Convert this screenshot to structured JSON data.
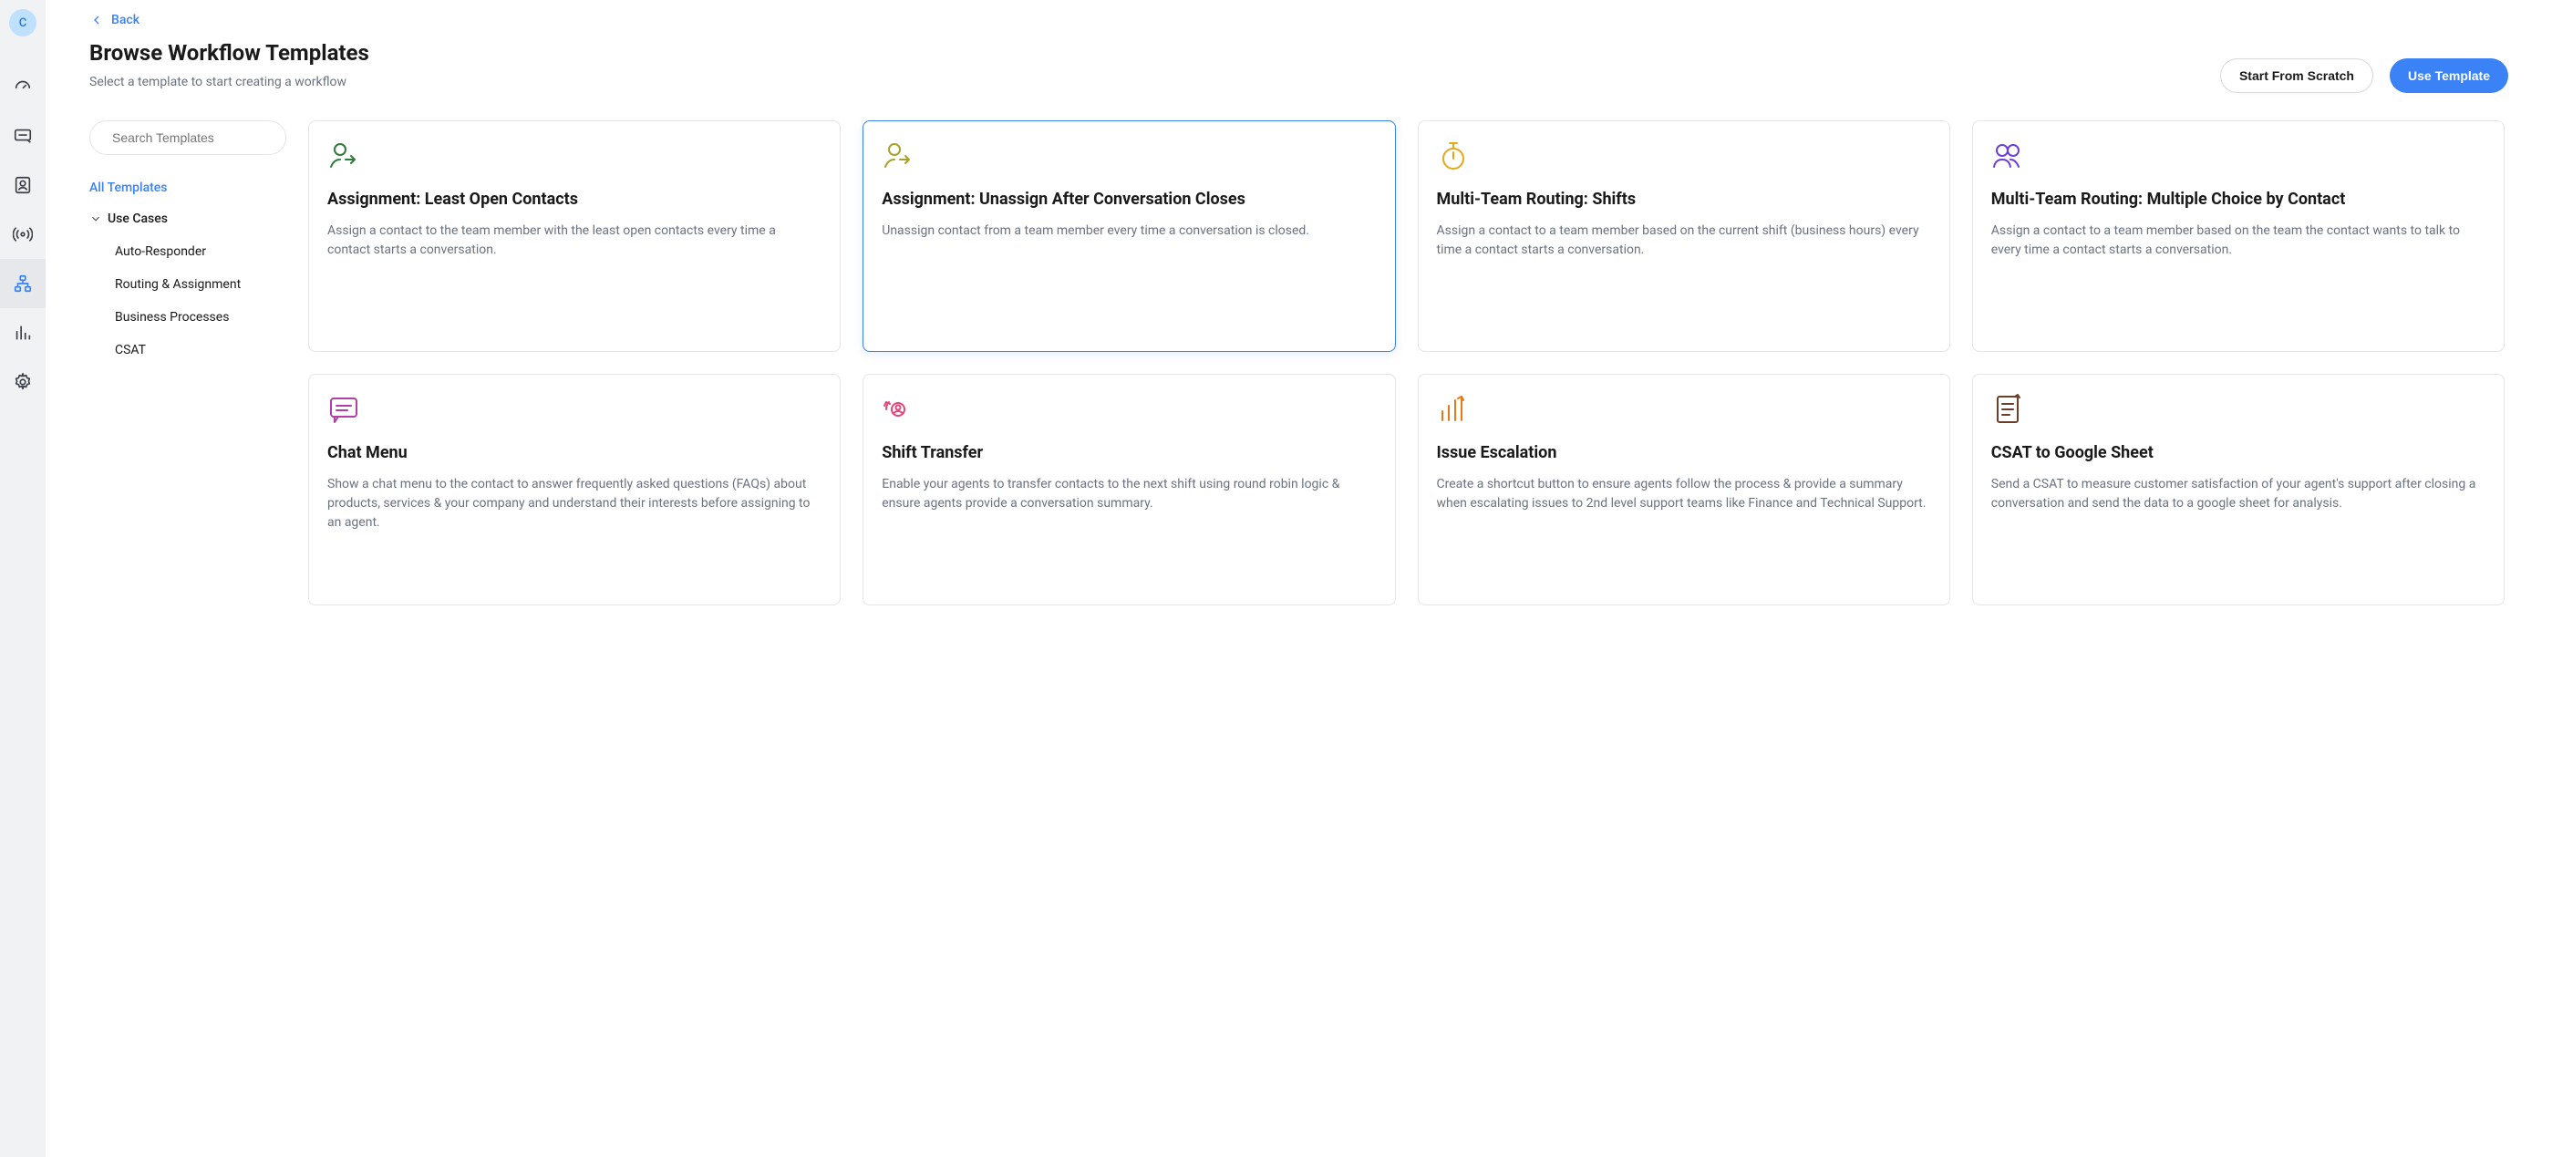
{
  "avatar_initial": "C",
  "back_label": "Back",
  "page_title": "Browse Workflow Templates",
  "page_subtitle": "Select a template to start creating a workflow",
  "actions": {
    "scratch": "Start From Scratch",
    "use_template": "Use Template"
  },
  "search_placeholder": "Search Templates",
  "filters": {
    "all": "All Templates",
    "group": "Use Cases",
    "items": [
      "Auto-Responder",
      "Routing & Assignment",
      "Business Processes",
      "CSAT"
    ]
  },
  "templates": [
    {
      "id": "assign-least-open",
      "icon": "user-arrow",
      "icon_color": "#2f7a3a",
      "title": "Assignment: Least Open Contacts",
      "desc": "Assign a contact to the team member with the least open contacts every time a contact starts a conversation.",
      "selected": false
    },
    {
      "id": "assign-unassign-close",
      "icon": "user-arrow",
      "icon_color": "#a8a12a",
      "title": "Assignment: Unassign After Conversation Closes",
      "desc": "Unassign contact from a team member every time a conversation is closed.",
      "selected": true
    },
    {
      "id": "multi-team-shifts",
      "icon": "stopwatch",
      "icon_color": "#e6a817",
      "title": "Multi-Team Routing: Shifts",
      "desc": "Assign a contact to a team member based on the current shift (business hours) every time a contact starts a conversation.",
      "selected": false
    },
    {
      "id": "multi-team-choice",
      "icon": "users",
      "icon_color": "#6b3fd6",
      "title": "Multi-Team Routing: Multiple Choice by Contact",
      "desc": "Assign a contact to a team member based on the team the contact wants to talk to every time a contact starts a conversation.",
      "selected": false
    },
    {
      "id": "chat-menu",
      "icon": "chat-bubble",
      "icon_color": "#b23fa8",
      "title": "Chat Menu",
      "desc": "Show a chat menu to the contact to answer frequently asked questions (FAQs) about products, services & your company and understand their interests before assigning to an agent.",
      "selected": false
    },
    {
      "id": "shift-transfer",
      "icon": "user-rotate",
      "icon_color": "#e0487a",
      "title": "Shift Transfer",
      "desc": "Enable your agents to transfer contacts to the next shift using round robin logic & ensure agents provide a conversation summary.",
      "selected": false
    },
    {
      "id": "issue-escalation",
      "icon": "bars-up",
      "icon_color": "#e67a17",
      "title": "Issue Escalation",
      "desc": "Create a shortcut button to ensure agents follow the process & provide a summary when escalating issues to 2nd level support teams like Finance and Technical Support.",
      "selected": false
    },
    {
      "id": "csat-gsheet",
      "icon": "document-check",
      "icon_color": "#6b3f2a",
      "title": "CSAT to Google Sheet",
      "desc": "Send a CSAT to measure customer satisfaction of your agent's support after closing a conversation and send the data to a google sheet for analysis.",
      "selected": false
    }
  ]
}
